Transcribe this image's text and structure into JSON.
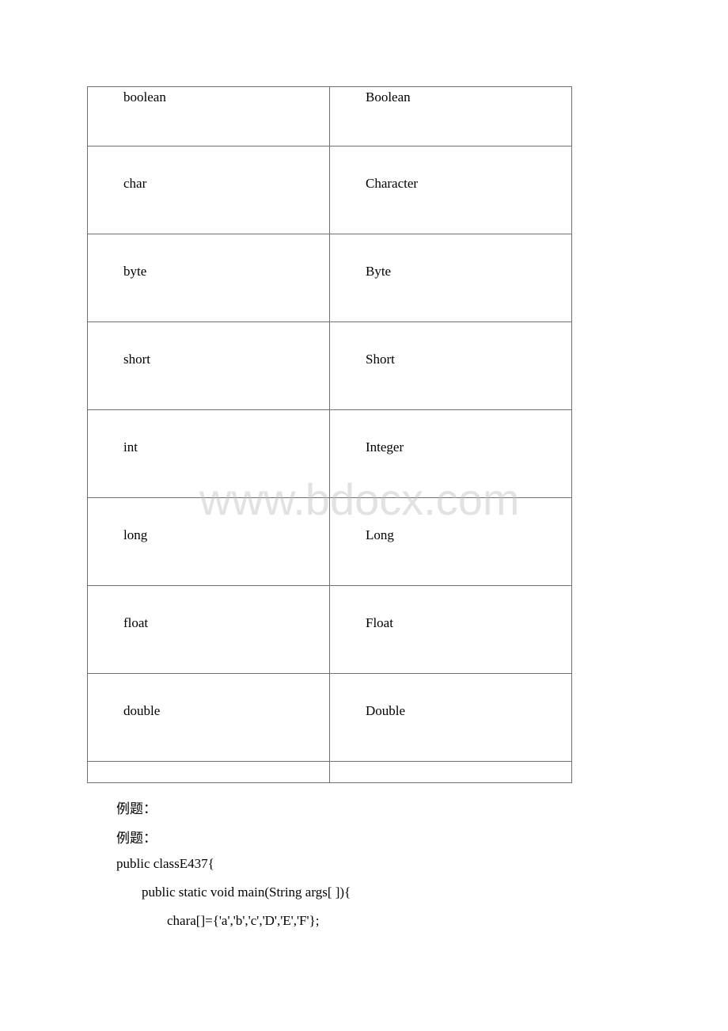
{
  "table": {
    "rows": [
      {
        "primitive": "boolean",
        "wrapper": "Boolean"
      },
      {
        "primitive": "char",
        "wrapper": "Character"
      },
      {
        "primitive": "byte",
        "wrapper": "Byte"
      },
      {
        "primitive": "short",
        "wrapper": "Short"
      },
      {
        "primitive": "int",
        "wrapper": "Integer"
      },
      {
        "primitive": "long",
        "wrapper": "Long"
      },
      {
        "primitive": "float",
        "wrapper": "Float"
      },
      {
        "primitive": "double",
        "wrapper": "Double"
      },
      {
        "primitive": "",
        "wrapper": ""
      }
    ]
  },
  "watermark": "www.bdocx.com",
  "body_lines": [
    "例题：",
    "例题：",
    "public classE437{",
    "public static void main(String args[ ]){",
    "chara[]={'a','b','c','D','E','F'};"
  ]
}
